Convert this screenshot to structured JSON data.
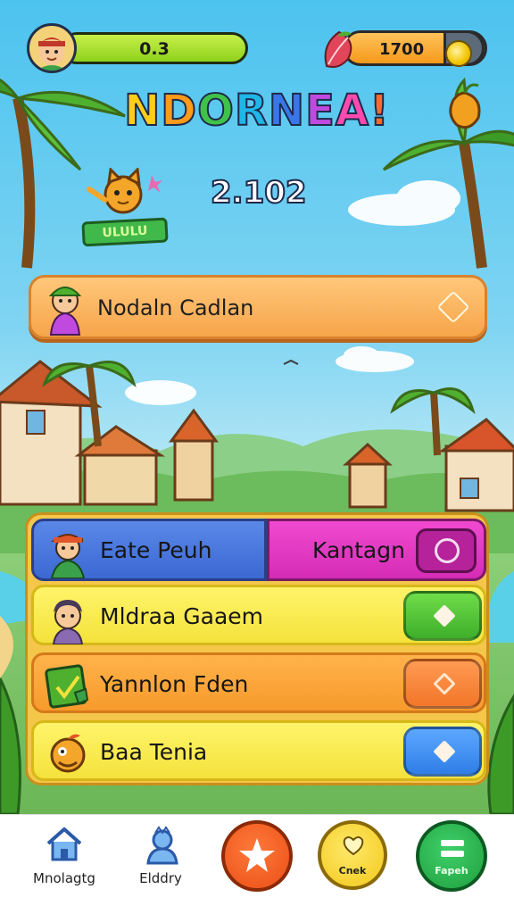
{
  "hud": {
    "level_value": "0.3",
    "coins_value": "1700",
    "icons": [
      "player-avatar",
      "leaf-icon",
      "coin-icon"
    ]
  },
  "title": {
    "letters": [
      {
        "ch": "N",
        "color": "#ffcc1a"
      },
      {
        "ch": "D",
        "color": "#ff9a1a"
      },
      {
        "ch": "O",
        "color": "#3fc24a"
      },
      {
        "ch": "R",
        "color": "#1fb6e8"
      },
      {
        "ch": "N",
        "color": "#3a76e8"
      },
      {
        "ch": "E",
        "color": "#c04ae0"
      },
      {
        "ch": "A",
        "color": "#ff4ab0"
      },
      {
        "ch": "!",
        "color": "#ff6a2a"
      }
    ],
    "score": "2.102",
    "mascot_sign": "ULULU"
  },
  "banner": {
    "label": "Nodaln Cadlan"
  },
  "menu": {
    "row1_left": "Eate Peuh",
    "row1_right": "Kantagn",
    "row2": "Mldraa Gaaem",
    "row3": "Yannlon Fden",
    "row4": "Baa Tenia"
  },
  "nav": {
    "home_label": "Mnolagtg",
    "profile_label": "Elddry",
    "coin_label": "Cnek",
    "green_label": "Fapeh"
  },
  "colors": {
    "sky": "#4cc3ef",
    "panel": "#f4c64a",
    "banner": "#f7a54a",
    "blue_seg": "#3c68d2",
    "pink_seg": "#d52cb6"
  }
}
